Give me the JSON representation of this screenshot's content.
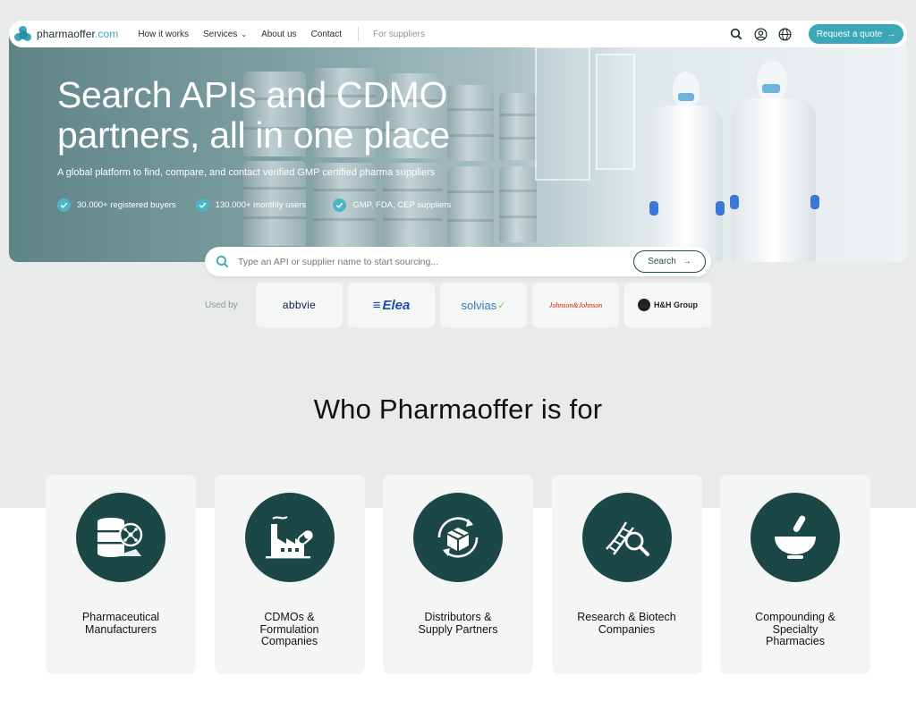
{
  "nav": {
    "logo_name": "pharmaoffer",
    "logo_tld": ".com",
    "links": [
      "How it works",
      "Services",
      "About us",
      "Contact"
    ],
    "services_chevron": "⌄",
    "suppliers": "For suppliers",
    "quote_button": "Request a quote",
    "quote_arrow": "→"
  },
  "hero": {
    "title": "Search APIs and CDMO partners, all in one place",
    "subtitle": "A global platform to find, compare, and contact verified GMP certified pharma suppliers",
    "stats": [
      "30.000+ registered buyers",
      "130.000+ monthly users",
      "GMP, FDA, CEP suppliers"
    ]
  },
  "search": {
    "placeholder": "Type an API or supplier name to start sourcing...",
    "button": "Search",
    "arrow": "→"
  },
  "used_by": {
    "label": "Used by",
    "logos": [
      "abbvie",
      "Elea",
      "solvias",
      "Johnson&Johnson",
      "H&H Group"
    ]
  },
  "who": {
    "title": "Who Pharmaoffer is for",
    "cards": [
      {
        "label": "Pharmaceutical\nManufacturers",
        "icon": "barrel-molecule-icon"
      },
      {
        "label": "CDMOs &\nFormulation\nCompanies",
        "icon": "factory-icon"
      },
      {
        "label": "Distributors &\nSupply Partners",
        "icon": "box-cycle-icon"
      },
      {
        "label": "Research & Biotech\nCompanies",
        "icon": "dna-magnifier-icon"
      },
      {
        "label": "Compounding &\nSpecialty\nPharmacies",
        "icon": "mortar-pestle-icon"
      }
    ]
  },
  "colors": {
    "accent": "#3aa8b8",
    "dark_teal": "#1b4746",
    "page_gray": "#e9ebeb"
  }
}
